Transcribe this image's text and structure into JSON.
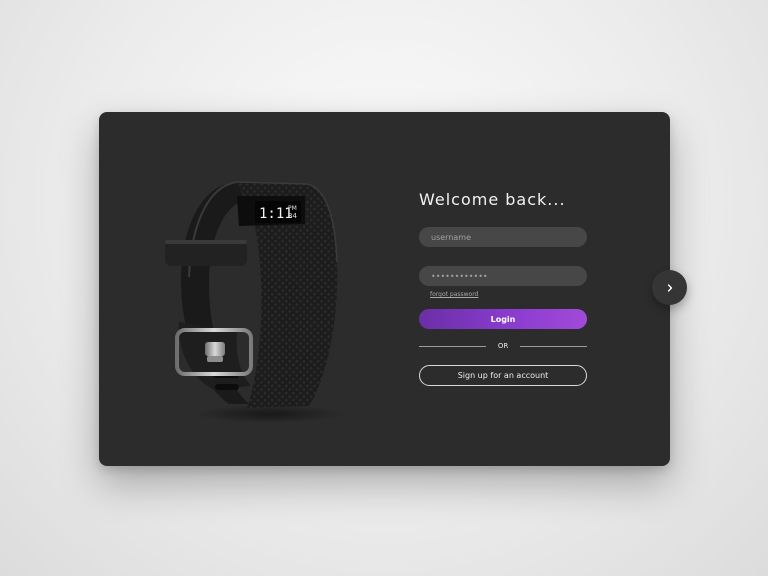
{
  "product": {
    "watch_time": "1:11",
    "watch_meridiem": "PM",
    "watch_seconds": "34"
  },
  "login_form": {
    "title": "Welcome back...",
    "username_placeholder": "username",
    "password_placeholder": "••••••••••••",
    "forgot_password_label": "forgot password",
    "login_label": "Login",
    "divider_label": "OR",
    "signup_label": "Sign up for an account"
  },
  "navigation": {
    "next_icon": "chevron-right-icon"
  },
  "colors": {
    "card_background": "#2c2c2c",
    "accent_start": "#6a2fa6",
    "accent_end": "#a24ad9",
    "input_background": "#474747"
  }
}
